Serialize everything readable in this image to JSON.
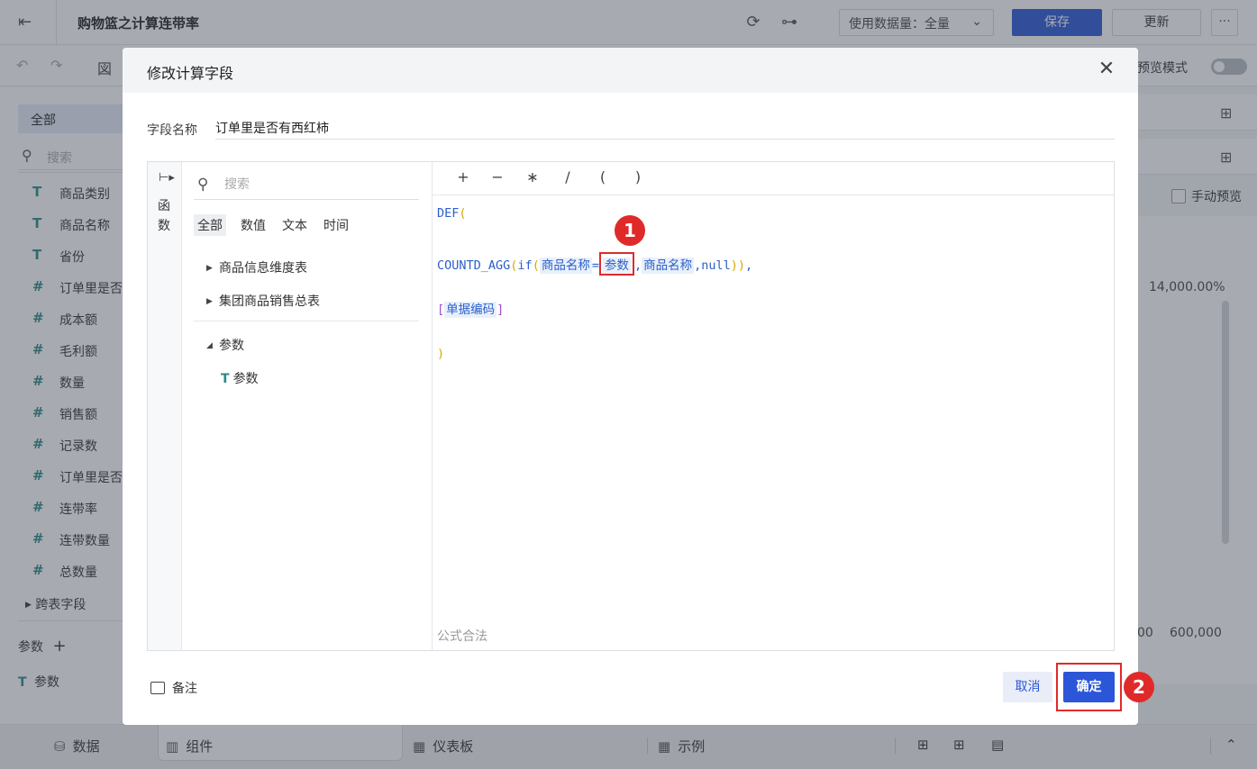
{
  "app": {
    "title": "购物篮之计算连带率",
    "data_volume": "使用数据量：全量",
    "save_label": "保存",
    "update_label": "更新",
    "more_label": "···",
    "preview_mode": "预览模式"
  },
  "left_panel": {
    "all_label": "全部",
    "search_placeholder": "搜索",
    "fields": [
      {
        "type": "T",
        "label": "商品类别"
      },
      {
        "type": "T",
        "label": "商品名称"
      },
      {
        "type": "T",
        "label": "省份"
      },
      {
        "type": "#",
        "label": "订单里是否"
      },
      {
        "type": "#",
        "label": "成本额"
      },
      {
        "type": "#",
        "label": "毛利额"
      },
      {
        "type": "#",
        "label": "数量"
      },
      {
        "type": "#",
        "label": "销售额"
      },
      {
        "type": "#",
        "label": "记录数"
      },
      {
        "type": "#",
        "label": "订单里是否"
      },
      {
        "type": "#",
        "label": "连带率"
      },
      {
        "type": "#",
        "label": "连带数量"
      },
      {
        "type": "#",
        "label": "总数量"
      }
    ],
    "cross_table": "跨表字段",
    "params_header": "参数",
    "params_add": "+",
    "param_item": "参数"
  },
  "right_panel": {
    "manual_preview": "手动预览",
    "pct_label": "14,000.00%",
    "axis_a": "00",
    "axis_b": "600,000"
  },
  "bottom_bar": {
    "data": "数据",
    "component": "组件",
    "dashboard": "仪表板",
    "example": "示例"
  },
  "dialog": {
    "title": "修改计算字段",
    "close": "✕",
    "field_name_label": "字段名称",
    "field_name_value": "订单里是否有西红柿",
    "rail_label": "函数",
    "fn_search_placeholder": "搜索",
    "fn_tabs": [
      "全部",
      "数值",
      "文本",
      "时间"
    ],
    "tables": [
      "商品信息维度表",
      "集团商品销售总表"
    ],
    "param_group": "参数",
    "param_item": "参数",
    "operators": [
      "+",
      "−",
      "∗",
      "/",
      "(",
      ")"
    ],
    "formula": {
      "line1": "DEF",
      "line1_paren": "(",
      "line2_fn": "COUNTD_AGG",
      "line2_if": "if",
      "token_a": "商品名称",
      "eq": "=",
      "token_param": "参数",
      "comma1": ",",
      "token_b": "商品名称",
      "null_part": ",null",
      "close_parens": "))",
      "comma2": ",",
      "bracket_open": "[",
      "token_c": "单据编码",
      "bracket_close": "]",
      "line4": ")"
    },
    "validity": "公式合法",
    "note_label": "备注",
    "cancel_label": "取消",
    "ok_label": "确定",
    "marker_1": "1",
    "marker_2": "2"
  }
}
